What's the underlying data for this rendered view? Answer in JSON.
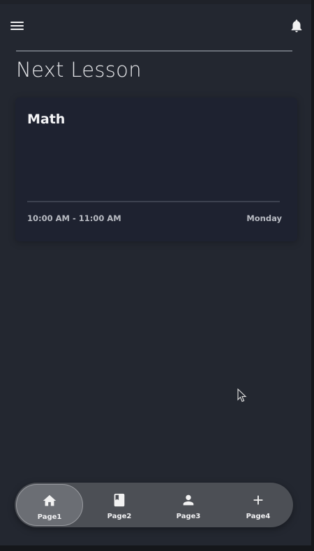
{
  "header": {
    "menu_icon": "hamburger-menu-icon",
    "notification_icon": "bell-icon"
  },
  "main": {
    "title": "Next Lesson",
    "lesson_card": {
      "subject": "Math",
      "time": "10:00 AM - 11:00 AM",
      "day": "Monday"
    }
  },
  "bottom_nav": {
    "items": [
      {
        "label": "Page1",
        "icon": "home-icon",
        "active": true
      },
      {
        "label": "Page2",
        "icon": "book-icon",
        "active": false
      },
      {
        "label": "Page3",
        "icon": "person-icon",
        "active": false
      },
      {
        "label": "Page4",
        "icon": "plus-icon",
        "active": false
      }
    ]
  },
  "colors": {
    "background": "#232730",
    "card_background": "#1e2230",
    "nav_background": "#4c4f55",
    "nav_active": "#6b6e74",
    "text_primary": "#f4f4f6",
    "text_secondary": "#b9bcc3"
  }
}
